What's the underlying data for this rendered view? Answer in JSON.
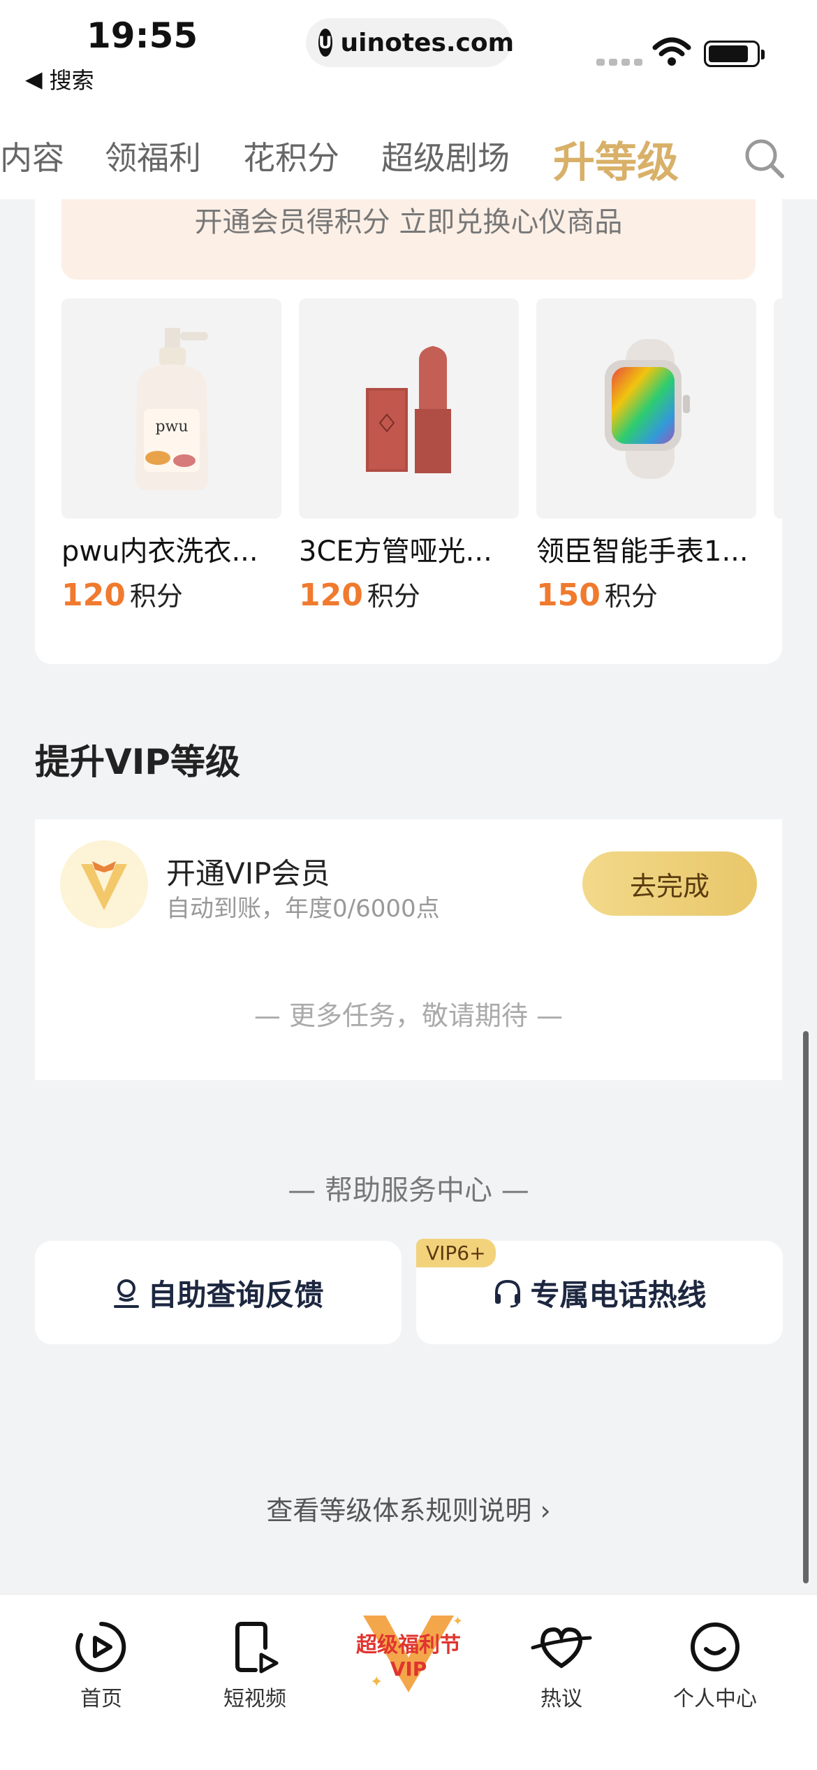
{
  "status_bar": {
    "time": "19:55",
    "back_label": "搜索",
    "url": "uinotes.com"
  },
  "top_nav": {
    "tabs": [
      {
        "label": "内容"
      },
      {
        "label": "领福利"
      },
      {
        "label": "花积分"
      },
      {
        "label": "超级剧场"
      },
      {
        "label": "升等级",
        "active": true
      }
    ]
  },
  "rewards": {
    "banner_text": "开通会员得积分 立即兑换心仪商品",
    "points_unit": "积分",
    "products": [
      {
        "name": "pwu内衣洗衣...",
        "points": "120"
      },
      {
        "name": "3CE方管哑光...",
        "points": "120"
      },
      {
        "name": "领臣智能手表1...",
        "points": "150"
      }
    ]
  },
  "vip_section": {
    "title": "提升VIP等级",
    "task_title": "开通VIP会员",
    "task_subtitle": "自动到账，年度0/6000点",
    "task_button": "去完成",
    "more_tasks": "— 更多任务，敬请期待 —"
  },
  "help": {
    "title": "— 帮助服务中心 —",
    "self_service": "自助查询反馈",
    "hotline": "专属电话热线",
    "hotline_tag": "VIP6+"
  },
  "rules_link": "查看等级体系规则说明 ›",
  "tab_bar": {
    "items": [
      {
        "label": "首页"
      },
      {
        "label": "短视频"
      },
      {
        "label": "热议"
      },
      {
        "label": "个人中心"
      }
    ],
    "center_badge_line1": "超级福利节",
    "center_badge_line2": "VIP"
  },
  "colors": {
    "accent_gold": "#d8b068",
    "points_orange": "#f07a2e",
    "banner_bg": "#fcefe6"
  }
}
